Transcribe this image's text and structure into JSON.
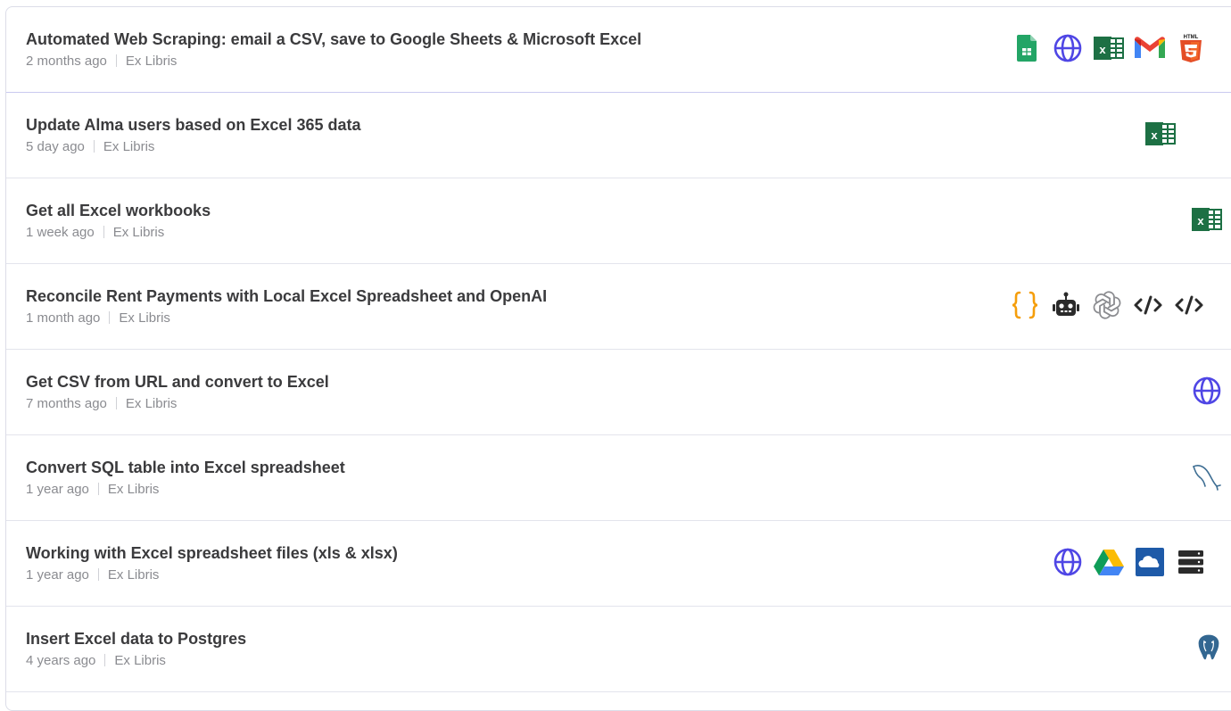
{
  "workflows": [
    {
      "title": "Automated Web Scraping: email a CSV, save to Google Sheets & Microsoft Excel",
      "time": "2 months ago",
      "author": "Ex Libris",
      "icons": [
        "google-sheets-icon",
        "globe-icon",
        "excel-icon",
        "gmail-icon",
        "html5-icon"
      ]
    },
    {
      "title": "Update Alma users based on Excel 365 data",
      "time": "5 day ago",
      "author": "Ex Libris",
      "icons": [
        "excel-icon"
      ]
    },
    {
      "title": "Get all Excel workbooks",
      "time": "1 week ago",
      "author": "Ex Libris",
      "icons": [
        "excel-icon"
      ]
    },
    {
      "title": "Reconcile Rent Payments with Local Excel Spreadsheet and OpenAI",
      "time": "1 month ago",
      "author": "Ex Libris",
      "icons": [
        "code-braces-icon",
        "robot-icon",
        "openai-icon",
        "code-tag-icon",
        "code-tag-icon"
      ]
    },
    {
      "title": "Get CSV from URL and convert to Excel",
      "time": "7 months ago",
      "author": "Ex Libris",
      "icons": [
        "globe-icon"
      ]
    },
    {
      "title": "Convert SQL table into Excel spreadsheet",
      "time": "1 year ago",
      "author": "Ex Libris",
      "icons": [
        "mysql-icon"
      ]
    },
    {
      "title": "Working with Excel spreadsheet files (xls & xlsx)",
      "time": "1 year ago",
      "author": "Ex Libris",
      "icons": [
        "globe-icon",
        "google-drive-icon",
        "onedrive-icon",
        "server-icon"
      ]
    },
    {
      "title": "Insert Excel data to Postgres",
      "time": "4 years ago",
      "author": "Ex Libris",
      "icons": [
        "postgres-icon"
      ]
    }
  ],
  "colors": {
    "globe": "#4f46e5",
    "excel": "#1d7044",
    "sheets": "#23a566",
    "braces": "#f59e0b",
    "dark": "#2b2b2b"
  }
}
